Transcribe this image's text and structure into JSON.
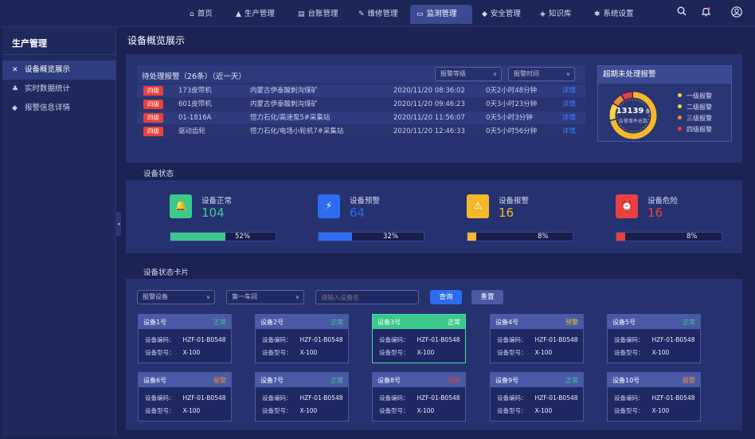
{
  "nav": {
    "items": [
      {
        "icon": "home-icon",
        "glyph": "⌂",
        "label": "首页"
      },
      {
        "icon": "factory-icon",
        "glyph": "▲",
        "label": "生产管理"
      },
      {
        "icon": "ledger-icon",
        "glyph": "▤",
        "label": "台账管理"
      },
      {
        "icon": "repair-icon",
        "glyph": "✎",
        "label": "维修管理"
      },
      {
        "icon": "monitor-icon",
        "glyph": "▭",
        "label": "监测管理"
      },
      {
        "icon": "shield-icon",
        "glyph": "◆",
        "label": "安全管理"
      },
      {
        "icon": "graduation-icon",
        "glyph": "◈",
        "label": "知识库"
      },
      {
        "icon": "gear-icon",
        "glyph": "✱",
        "label": "系统设置"
      }
    ]
  },
  "sidebar": {
    "title": "生产管理",
    "items": [
      {
        "label": "设备概览展示",
        "icon": "tools-icon",
        "glyph": "✕"
      },
      {
        "label": "实时数据统计",
        "icon": "user-chart-icon",
        "glyph": "♣"
      },
      {
        "label": "报警信息详情",
        "icon": "shield-icon",
        "glyph": "◆"
      }
    ]
  },
  "page_title": "设备概览展示",
  "alarms": {
    "title": "待处理报警（26条）（近一天）",
    "level_filter": "报警等级",
    "time_filter": "报警时间",
    "rows": [
      {
        "level": "四级",
        "device": "173皮带机",
        "location": "内蒙古伊泰酸刺沟煤矿",
        "time": "2020/11/20 08:36:02",
        "duration": "0天2小时48分钟",
        "action": "详情"
      },
      {
        "level": "四级",
        "device": "601皮带机",
        "location": "内蒙古伊泰酸刺沟煤矿",
        "time": "2020/11/20 09:46:23",
        "duration": "0天3小时23分钟",
        "action": "详情"
      },
      {
        "level": "四级",
        "device": "01-1816A",
        "location": "恒力石化/高速泵5#采集站",
        "time": "2020/11/20 11:56:07",
        "duration": "0天5小时3分钟",
        "action": "详情"
      },
      {
        "level": "四级",
        "device": "驱动齿轮",
        "location": "恒力石化/电场小轮机7#采集站",
        "time": "2020/11/20 12:46:33",
        "duration": "0天5小时56分钟",
        "action": "详情"
      }
    ]
  },
  "overdue": {
    "title": "超期未处理报警",
    "total": "13139",
    "unit": "条",
    "caption": "告警事件总数",
    "legend": [
      {
        "label": "一级报警",
        "color": "#f5d547"
      },
      {
        "label": "二级报警",
        "color": "#f5d547"
      },
      {
        "label": "三级报警",
        "color": "#f08c2c"
      },
      {
        "label": "四级报警",
        "color": "#e8413e"
      }
    ],
    "segments": [
      0.72,
      0.12,
      0.08,
      0.08
    ]
  },
  "status": {
    "title": "设备状态",
    "items": [
      {
        "label": "设备正常",
        "value": "104",
        "pct": "52%",
        "fraction": 0.52,
        "color": "#3cc98e",
        "icon": "bell-icon",
        "glyph": "🔔"
      },
      {
        "label": "设备预警",
        "value": "64",
        "pct": "32%",
        "fraction": 0.32,
        "color": "#2d6cf0",
        "icon": "lightning-icon",
        "glyph": "⚡"
      },
      {
        "label": "设备报警",
        "value": "16",
        "pct": "8%",
        "fraction": 0.08,
        "color": "#f5b82a",
        "icon": "warning-icon",
        "glyph": "⚠"
      },
      {
        "label": "设备危险",
        "value": "16",
        "pct": "8%",
        "fraction": 0.08,
        "color": "#e8413e",
        "icon": "siren-icon",
        "glyph": "⏰"
      }
    ]
  },
  "cards": {
    "title": "设备状态卡片",
    "filter_device": "报警设备",
    "filter_workshop": "第一车间",
    "search_placeholder": "请输入设备名",
    "query_label": "查询",
    "reset_label": "重置",
    "code_label": "设备编码：",
    "model_label": "设备型号：",
    "items": [
      {
        "name": "设备1号",
        "state": "正常",
        "state_color": "#3cc98e",
        "code": "HZF-01-B0548",
        "model": "X-100"
      },
      {
        "name": "设备2号",
        "state": "正常",
        "state_color": "#3cc98e",
        "code": "HZF-01-B0548",
        "model": "X-100"
      },
      {
        "name": "设备3号",
        "state": "正常",
        "state_color": "#ffffff",
        "code": "HZF-01-B0548",
        "model": "X-100",
        "selected": true
      },
      {
        "name": "设备4号",
        "state": "预警",
        "state_color": "#f5b82a",
        "code": "HZF-01-B0548",
        "model": "X-100"
      },
      {
        "name": "设备5号",
        "state": "正常",
        "state_color": "#3cc98e",
        "code": "HZF-01-B0548",
        "model": "X-100"
      },
      {
        "name": "设备6号",
        "state": "报警",
        "state_color": "#f08c2c",
        "code": "HZF-01-B0548",
        "model": "X-100"
      },
      {
        "name": "设备7号",
        "state": "正常",
        "state_color": "#3cc98e",
        "code": "HZF-01-B0548",
        "model": "X-100"
      },
      {
        "name": "设备8号",
        "state": "危险",
        "state_color": "#e8413e",
        "code": "HZF-01-B0548",
        "model": "X-100"
      },
      {
        "name": "设备9号",
        "state": "正常",
        "state_color": "#3cc98e",
        "code": "HZF-01-B0548",
        "model": "X-100"
      },
      {
        "name": "设备10号",
        "state": "报警",
        "state_color": "#f08c2c",
        "code": "HZF-01-B0548",
        "model": "X-100"
      }
    ]
  }
}
